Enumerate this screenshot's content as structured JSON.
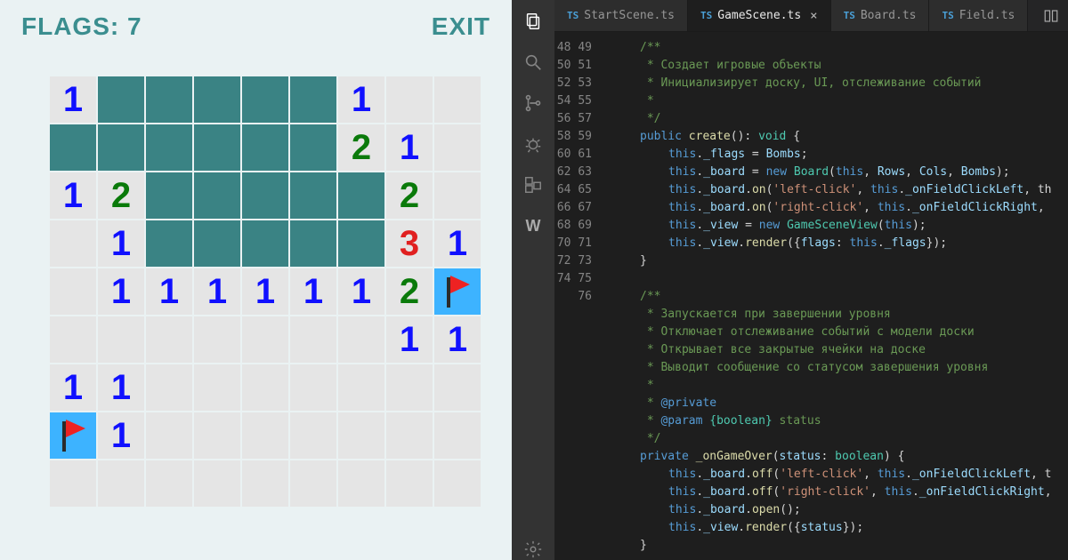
{
  "game": {
    "flags_label": "FLAGS: 7",
    "exit_label": "EXIT",
    "cols": 9,
    "rows": 9,
    "cells": [
      [
        "1",
        "h",
        "h",
        "h",
        "h",
        "h",
        "1",
        "",
        ""
      ],
      [
        "h",
        "h",
        "h",
        "h",
        "h",
        "h",
        "2",
        "1",
        ""
      ],
      [
        "1",
        "2",
        "h",
        "h",
        "h",
        "h",
        "h",
        "2",
        ""
      ],
      [
        "",
        "1",
        "h",
        "h",
        "h",
        "h",
        "h",
        "3",
        "1"
      ],
      [
        "",
        "1",
        "1",
        "1",
        "1",
        "1",
        "1",
        "2",
        "F"
      ],
      [
        "",
        "",
        "",
        "",
        "",
        "",
        "",
        "1",
        "1"
      ],
      [
        "1",
        "1",
        "",
        "",
        "",
        "",
        "",
        "",
        ""
      ],
      [
        "F",
        "1",
        "",
        "",
        "",
        "",
        "",
        "",
        ""
      ],
      [
        "",
        "",
        "",
        "",
        "",
        "",
        "",
        "",
        ""
      ]
    ]
  },
  "ide": {
    "tabs": [
      {
        "label": "StartScene.ts",
        "active": false
      },
      {
        "label": "GameScene.ts",
        "active": true
      },
      {
        "label": "Board.ts",
        "active": false
      },
      {
        "label": "Field.ts",
        "active": false
      }
    ],
    "first_line": 48,
    "lines": [
      [
        {
          "c": "cmt",
          "t": "/**",
          "i": 1
        }
      ],
      [
        {
          "c": "cmt",
          "t": " * Создает игровые объекты",
          "i": 1
        }
      ],
      [
        {
          "c": "cmt",
          "t": " * Инициализирует доску, UI, отслеживание событий",
          "i": 1
        }
      ],
      [
        {
          "c": "cmt",
          "t": " *",
          "i": 1
        }
      ],
      [
        {
          "c": "cmt",
          "t": " */",
          "i": 1
        }
      ],
      [
        {
          "c": "kw",
          "t": "public ",
          "i": 1
        },
        {
          "c": "fn",
          "t": "create"
        },
        {
          "c": "pun",
          "t": "(): "
        },
        {
          "c": "type",
          "t": "void"
        },
        {
          "c": "pun",
          "t": " {"
        }
      ],
      [
        {
          "c": "this",
          "t": "this",
          "i": 2
        },
        {
          "c": "pun",
          "t": "."
        },
        {
          "c": "var",
          "t": "_flags"
        },
        {
          "c": "pun",
          "t": " = "
        },
        {
          "c": "var",
          "t": "Bombs"
        },
        {
          "c": "pun",
          "t": ";"
        }
      ],
      [
        {
          "c": "this",
          "t": "this",
          "i": 2
        },
        {
          "c": "pun",
          "t": "."
        },
        {
          "c": "var",
          "t": "_board"
        },
        {
          "c": "pun",
          "t": " = "
        },
        {
          "c": "kw",
          "t": "new "
        },
        {
          "c": "type",
          "t": "Board"
        },
        {
          "c": "pun",
          "t": "("
        },
        {
          "c": "this",
          "t": "this"
        },
        {
          "c": "pun",
          "t": ", "
        },
        {
          "c": "var",
          "t": "Rows"
        },
        {
          "c": "pun",
          "t": ", "
        },
        {
          "c": "var",
          "t": "Cols"
        },
        {
          "c": "pun",
          "t": ", "
        },
        {
          "c": "var",
          "t": "Bombs"
        },
        {
          "c": "pun",
          "t": ");"
        }
      ],
      [
        {
          "c": "this",
          "t": "this",
          "i": 2
        },
        {
          "c": "pun",
          "t": "."
        },
        {
          "c": "var",
          "t": "_board"
        },
        {
          "c": "pun",
          "t": "."
        },
        {
          "c": "fn",
          "t": "on"
        },
        {
          "c": "pun",
          "t": "("
        },
        {
          "c": "str",
          "t": "'left-click'"
        },
        {
          "c": "pun",
          "t": ", "
        },
        {
          "c": "this",
          "t": "this"
        },
        {
          "c": "pun",
          "t": "."
        },
        {
          "c": "var",
          "t": "_onFieldClickLeft"
        },
        {
          "c": "pun",
          "t": ", th"
        }
      ],
      [
        {
          "c": "this",
          "t": "this",
          "i": 2
        },
        {
          "c": "pun",
          "t": "."
        },
        {
          "c": "var",
          "t": "_board"
        },
        {
          "c": "pun",
          "t": "."
        },
        {
          "c": "fn",
          "t": "on"
        },
        {
          "c": "pun",
          "t": "("
        },
        {
          "c": "str",
          "t": "'right-click'"
        },
        {
          "c": "pun",
          "t": ", "
        },
        {
          "c": "this",
          "t": "this"
        },
        {
          "c": "pun",
          "t": "."
        },
        {
          "c": "var",
          "t": "_onFieldClickRight"
        },
        {
          "c": "pun",
          "t": ","
        }
      ],
      [
        {
          "c": "this",
          "t": "this",
          "i": 2
        },
        {
          "c": "pun",
          "t": "."
        },
        {
          "c": "var",
          "t": "_view"
        },
        {
          "c": "pun",
          "t": " = "
        },
        {
          "c": "kw",
          "t": "new "
        },
        {
          "c": "type",
          "t": "GameSceneView"
        },
        {
          "c": "pun",
          "t": "("
        },
        {
          "c": "this",
          "t": "this"
        },
        {
          "c": "pun",
          "t": ");"
        }
      ],
      [
        {
          "c": "this",
          "t": "this",
          "i": 2
        },
        {
          "c": "pun",
          "t": "."
        },
        {
          "c": "var",
          "t": "_view"
        },
        {
          "c": "pun",
          "t": "."
        },
        {
          "c": "fn",
          "t": "render"
        },
        {
          "c": "pun",
          "t": "({"
        },
        {
          "c": "var",
          "t": "flags"
        },
        {
          "c": "pun",
          "t": ": "
        },
        {
          "c": "this",
          "t": "this"
        },
        {
          "c": "pun",
          "t": "."
        },
        {
          "c": "var",
          "t": "_flags"
        },
        {
          "c": "pun",
          "t": "});"
        }
      ],
      [
        {
          "c": "pun",
          "t": "}",
          "i": 1
        }
      ],
      [],
      [
        {
          "c": "cmt",
          "t": "/**",
          "i": 1
        }
      ],
      [
        {
          "c": "cmt",
          "t": " * Запускается при завершении уровня",
          "i": 1
        }
      ],
      [
        {
          "c": "cmt",
          "t": " * Отключает отслеживание событий с модели доски",
          "i": 1
        }
      ],
      [
        {
          "c": "cmt",
          "t": " * Открывает все закрытые ячейки на доске",
          "i": 1
        }
      ],
      [
        {
          "c": "cmt",
          "t": " * Выводит сообщение со статусом завершения уровня",
          "i": 1
        }
      ],
      [
        {
          "c": "cmt",
          "t": " *",
          "i": 1
        }
      ],
      [
        {
          "c": "cmt",
          "t": " * ",
          "i": 1
        },
        {
          "c": "dtag",
          "t": "@private"
        }
      ],
      [
        {
          "c": "cmt",
          "t": " * ",
          "i": 1
        },
        {
          "c": "dtag",
          "t": "@param"
        },
        {
          "c": "cmt",
          "t": " "
        },
        {
          "c": "type",
          "t": "{boolean}"
        },
        {
          "c": "cmt",
          "t": " status"
        }
      ],
      [
        {
          "c": "cmt",
          "t": " */",
          "i": 1
        }
      ],
      [
        {
          "c": "kw",
          "t": "private ",
          "i": 1
        },
        {
          "c": "fn",
          "t": "_onGameOver"
        },
        {
          "c": "pun",
          "t": "("
        },
        {
          "c": "var",
          "t": "status"
        },
        {
          "c": "pun",
          "t": ": "
        },
        {
          "c": "type",
          "t": "boolean"
        },
        {
          "c": "pun",
          "t": ") {"
        }
      ],
      [
        {
          "c": "this",
          "t": "this",
          "i": 2
        },
        {
          "c": "pun",
          "t": "."
        },
        {
          "c": "var",
          "t": "_board"
        },
        {
          "c": "pun",
          "t": "."
        },
        {
          "c": "fn",
          "t": "off"
        },
        {
          "c": "pun",
          "t": "("
        },
        {
          "c": "str",
          "t": "'left-click'"
        },
        {
          "c": "pun",
          "t": ", "
        },
        {
          "c": "this",
          "t": "this"
        },
        {
          "c": "pun",
          "t": "."
        },
        {
          "c": "var",
          "t": "_onFieldClickLeft"
        },
        {
          "c": "pun",
          "t": ", t"
        }
      ],
      [
        {
          "c": "this",
          "t": "this",
          "i": 2
        },
        {
          "c": "pun",
          "t": "."
        },
        {
          "c": "var",
          "t": "_board"
        },
        {
          "c": "pun",
          "t": "."
        },
        {
          "c": "fn",
          "t": "off"
        },
        {
          "c": "pun",
          "t": "("
        },
        {
          "c": "str",
          "t": "'right-click'"
        },
        {
          "c": "pun",
          "t": ", "
        },
        {
          "c": "this",
          "t": "this"
        },
        {
          "c": "pun",
          "t": "."
        },
        {
          "c": "var",
          "t": "_onFieldClickRight"
        },
        {
          "c": "pun",
          "t": ","
        }
      ],
      [
        {
          "c": "this",
          "t": "this",
          "i": 2
        },
        {
          "c": "pun",
          "t": "."
        },
        {
          "c": "var",
          "t": "_board"
        },
        {
          "c": "pun",
          "t": "."
        },
        {
          "c": "fn",
          "t": "open"
        },
        {
          "c": "pun",
          "t": "();"
        }
      ],
      [
        {
          "c": "this",
          "t": "this",
          "i": 2
        },
        {
          "c": "pun",
          "t": "."
        },
        {
          "c": "var",
          "t": "_view"
        },
        {
          "c": "pun",
          "t": "."
        },
        {
          "c": "fn",
          "t": "render"
        },
        {
          "c": "pun",
          "t": "({"
        },
        {
          "c": "var",
          "t": "status"
        },
        {
          "c": "pun",
          "t": "});"
        }
      ],
      [
        {
          "c": "pun",
          "t": "}",
          "i": 1
        }
      ]
    ]
  }
}
